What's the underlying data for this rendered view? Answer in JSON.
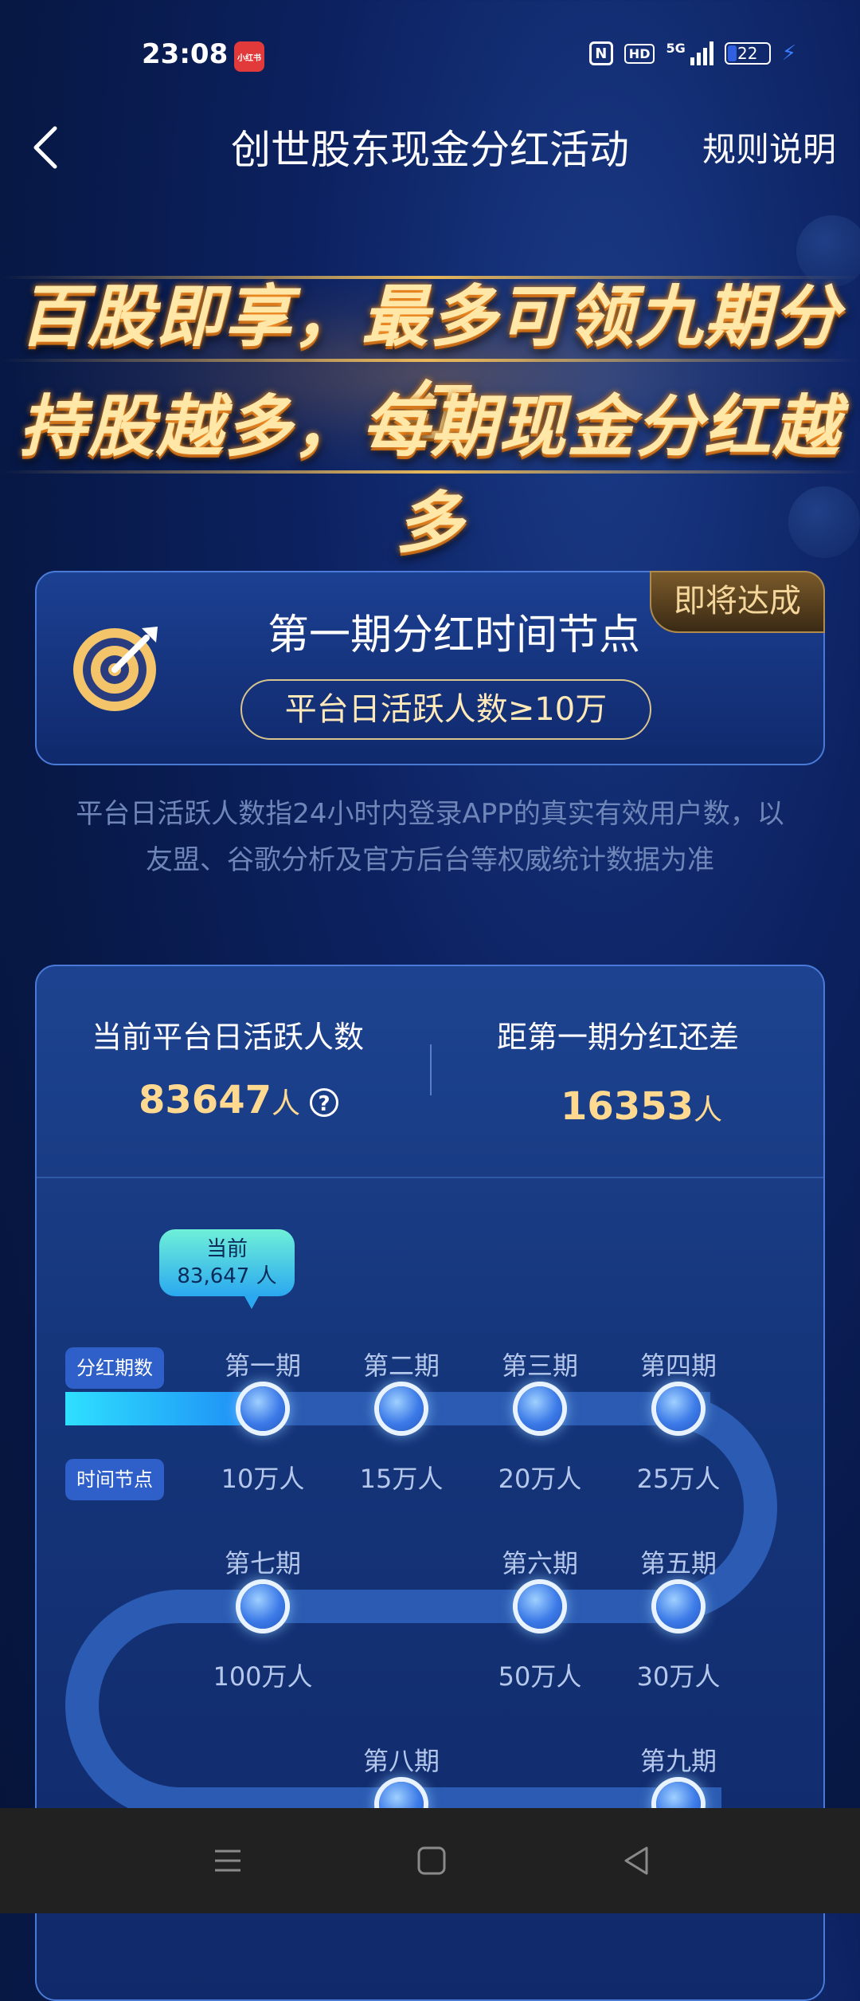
{
  "status_bar": {
    "time": "23:08",
    "app_badge": "小红书",
    "nfc": "N",
    "hd": "HD",
    "network": "5G",
    "battery": "22",
    "battery_level": 0.22,
    "icons": [
      "nfc-icon",
      "hd-icon",
      "signal-icon",
      "battery-icon",
      "charging-bolt-icon"
    ]
  },
  "nav": {
    "title": "创世股东现金分红活动",
    "rules": "规则说明",
    "back_icon": "chevron-left-icon"
  },
  "banner": {
    "line1": "百股即享，最多可领九期分红",
    "line2": "持股越多，每期现金分红越多"
  },
  "milestone": {
    "title": "第一期分红时间节点",
    "condition": "平台日活跃人数≥10万",
    "badge": "即将达成",
    "icon": "target-icon"
  },
  "description": "平台日活跃人数指24小时内登录APP的真实有效用户数，以友盟、谷歌分析及官方后台等权威统计数据为准",
  "stats": {
    "current_label": "当前平台日活跃人数",
    "current_value": "83647",
    "current_unit": "人",
    "remaining_label": "距第一期分红还差",
    "remaining_value": "16353",
    "remaining_unit": "人",
    "help_icon": "?"
  },
  "progress": {
    "bubble_title": "当前",
    "bubble_value": "83,647 人",
    "row_tag_phase": "分红期数",
    "row_tag_time": "时间节点",
    "phases": [
      {
        "label": "第一期",
        "value": "10万人"
      },
      {
        "label": "第二期",
        "value": "15万人"
      },
      {
        "label": "第三期",
        "value": "20万人"
      },
      {
        "label": "第四期",
        "value": "25万人"
      },
      {
        "label": "第五期",
        "value": "30万人"
      },
      {
        "label": "第六期",
        "value": "50万人"
      },
      {
        "label": "第七期",
        "value": "100万人"
      },
      {
        "label": "第八期",
        "value": ""
      },
      {
        "label": "第九期",
        "value": ""
      }
    ]
  },
  "bottom_nav": {
    "icons": [
      "menu-icon",
      "home-icon",
      "back-icon"
    ]
  },
  "colors": {
    "accent_gold": "#ffd990",
    "track": "#2b5bb2",
    "track_fill": "#2ee0ff",
    "background": "#0c2160"
  }
}
